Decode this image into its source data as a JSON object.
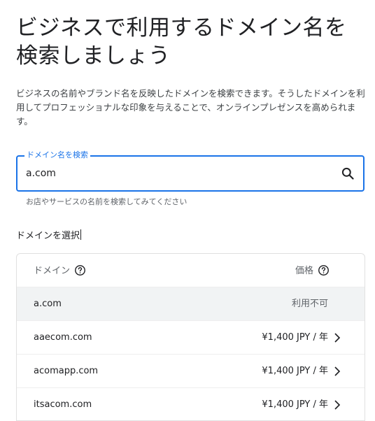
{
  "page": {
    "title": "ビジネスで利用するドメイン名を検索しましょう",
    "description": "ビジネスの名前やブランド名を反映したドメインを検索できます。そうしたドメインを利用してプロフェッショナルな印象を与えることで、オンラインプレゼンスを高められます。"
  },
  "search": {
    "label": "ドメイン名を検索",
    "value": "a.com",
    "helper": "お店やサービスの名前を検索してみてください"
  },
  "select": {
    "label": "ドメインを選択"
  },
  "table": {
    "header": {
      "domain": "ドメイン",
      "price": "価格"
    },
    "rows": [
      {
        "domain": "a.com",
        "price": "利用不可"
      },
      {
        "domain": "aaecom.com",
        "price": "¥1,400 JPY / 年"
      },
      {
        "domain": "acomapp.com",
        "price": "¥1,400 JPY / 年"
      },
      {
        "domain": "itsacom.com",
        "price": "¥1,400 JPY / 年"
      }
    ]
  },
  "colors": {
    "accent": "#1a73e8",
    "unavailable_bg": "#f1f3f4"
  }
}
